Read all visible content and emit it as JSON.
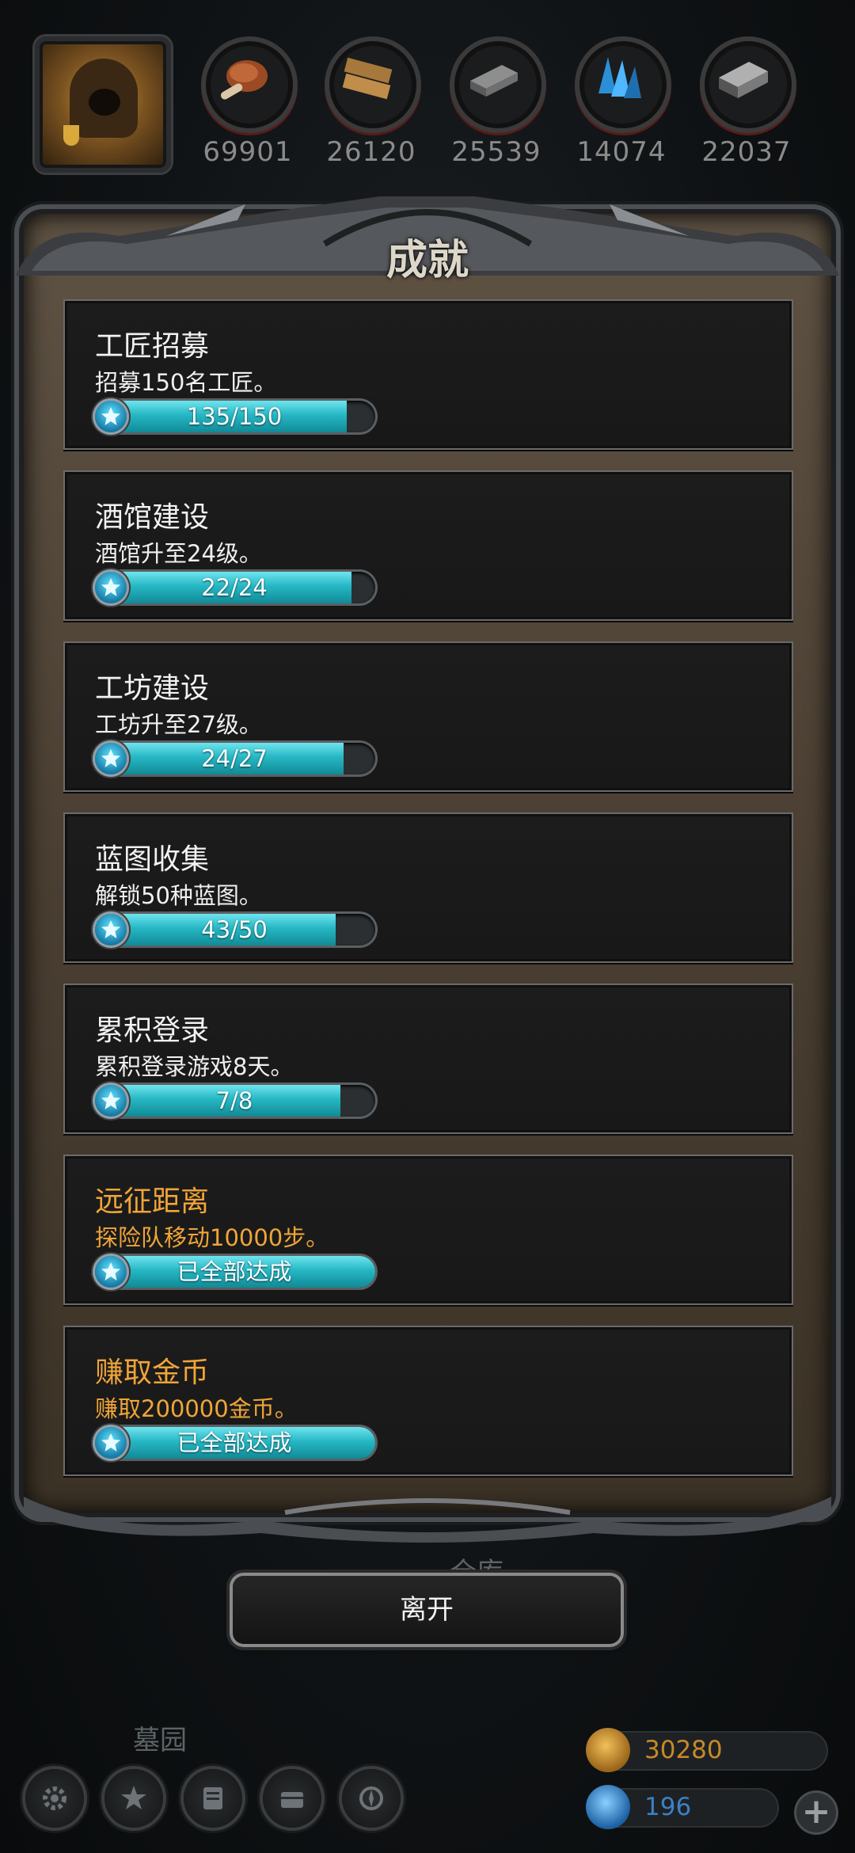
{
  "resources": [
    {
      "icon": "meat-icon",
      "value": "69901"
    },
    {
      "icon": "wood-plank-icon",
      "value": "26120"
    },
    {
      "icon": "iron-ingot-icon",
      "value": "25539"
    },
    {
      "icon": "crystal-icon",
      "value": "14074"
    },
    {
      "icon": "metal-bar-icon",
      "value": "22037"
    }
  ],
  "panel": {
    "title": "成就",
    "achievements": [
      {
        "name": "工匠招募",
        "desc": "招募150名工匠。",
        "progress_text": "135/150",
        "progress": 0.9,
        "completed": false
      },
      {
        "name": "酒馆建设",
        "desc": "酒馆升至24级。",
        "progress_text": "22/24",
        "progress": 0.917,
        "completed": false
      },
      {
        "name": "工坊建设",
        "desc": "工坊升至27级。",
        "progress_text": "24/27",
        "progress": 0.889,
        "completed": false
      },
      {
        "name": "蓝图收集",
        "desc": "解锁50种蓝图。",
        "progress_text": "43/50",
        "progress": 0.86,
        "completed": false
      },
      {
        "name": "累积登录",
        "desc": "累积登录游戏8天。",
        "progress_text": "7/8",
        "progress": 0.875,
        "completed": false
      },
      {
        "name": "远征距离",
        "desc": "探险队移动10000步。",
        "progress_text": "已全部达成",
        "progress": 1.0,
        "completed": true
      },
      {
        "name": "赚取金币",
        "desc": "赚取200000金币。",
        "progress_text": "已全部达成",
        "progress": 1.0,
        "completed": true
      }
    ]
  },
  "leave_label": "离开",
  "background_labels": {
    "warehouse": "仓库",
    "cemetery": "墓园"
  },
  "hud": {
    "gold": {
      "icon": "gold-coin-icon",
      "value": "30280",
      "color": "#c7892a"
    },
    "gems": {
      "icon": "gem-icon",
      "value": "196",
      "color": "#3d7fc4"
    },
    "add_icon": "plus-icon"
  },
  "colors": {
    "progress": "#2ec6d3",
    "completed_text": "#f0a537",
    "panel_frame": "#4b4e52"
  }
}
